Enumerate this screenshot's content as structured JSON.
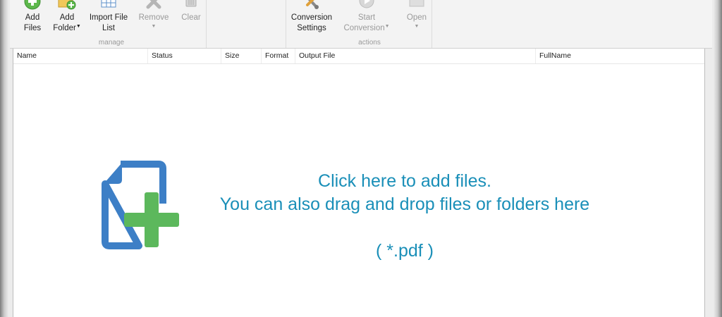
{
  "ribbon": {
    "manage": {
      "label": "manage",
      "add_files": {
        "line1": "Add",
        "line2": "Files"
      },
      "add_folder": {
        "line1": "Add",
        "line2": "Folder"
      },
      "import_file_list": {
        "line1": "Import File",
        "line2": "List"
      },
      "remove": {
        "line1": "Remove"
      },
      "clear": {
        "line1": "Clear"
      }
    },
    "actions": {
      "label": "actions",
      "conversion_settings": {
        "line1": "Conversion",
        "line2": "Settings"
      },
      "start_conversion": {
        "line1": "Start",
        "line2": "Conversion"
      },
      "open": {
        "line1": "Open"
      }
    }
  },
  "table": {
    "columns": [
      "Name",
      "Status",
      "Size",
      "Format",
      "Output File",
      "FullName"
    ]
  },
  "drop_zone": {
    "line1": "Click here to add files.",
    "line2": "You can also drag and drop files or folders here",
    "ext": "( *.pdf )"
  },
  "colors": {
    "accent_text": "#1a8fb8",
    "icon_blue": "#3d7fc6",
    "icon_green": "#5cb85c"
  }
}
